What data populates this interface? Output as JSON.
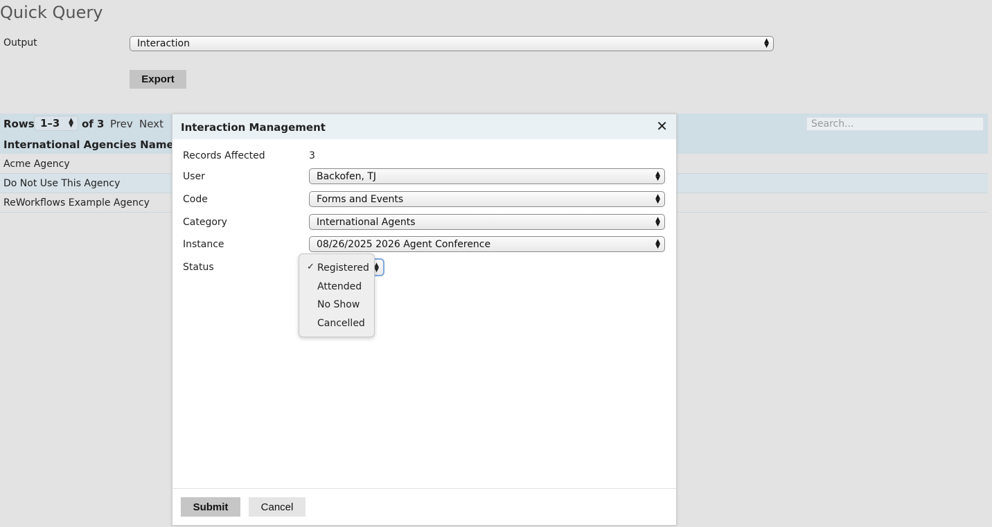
{
  "page": {
    "title": "Quick Query",
    "output_label": "Output",
    "output_value": "Interaction",
    "export_label": "Export"
  },
  "table": {
    "rows_label": "Rows",
    "rows_range": "1–3",
    "of_label": "of 3",
    "prev_label": "Prev",
    "next_label": "Next",
    "search_placeholder": "Search...",
    "column_header": "International Agencies Name",
    "rows": [
      "Acme Agency",
      "Do Not Use This Agency",
      "ReWorkflows Example Agency"
    ]
  },
  "modal": {
    "title": "Interaction Management",
    "close_icon": "close-icon",
    "fields": {
      "records_affected_label": "Records Affected",
      "records_affected_value": "3",
      "user_label": "User",
      "user_value": "Backofen, TJ",
      "code_label": "Code",
      "code_value": "Forms and Events",
      "category_label": "Category",
      "category_value": "International Agents",
      "instance_label": "Instance",
      "instance_value": "08/26/2025 2026 Agent Conference",
      "status_label": "Status"
    },
    "status_options": [
      "Registered",
      "Attended",
      "No Show",
      "Cancelled"
    ],
    "status_selected": "Registered",
    "submit_label": "Submit",
    "cancel_label": "Cancel"
  },
  "colors": {
    "background": "#e3e3e3",
    "table_header": "#cfdde5",
    "modal_header": "#eaf1f5",
    "focus_ring": "#7ea6e0"
  }
}
